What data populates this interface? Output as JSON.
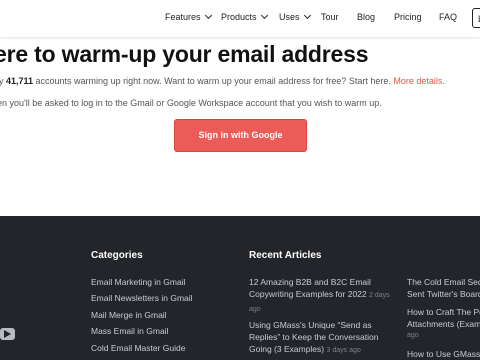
{
  "nav": {
    "features": "Features",
    "products": "Products",
    "uses": "Uses",
    "tour": "Tour",
    "blog": "Blog",
    "pricing": "Pricing",
    "faq": "FAQ",
    "login_partial": "L"
  },
  "hero": {
    "title": "ere to warm-up your email address",
    "line1_prefix": "ly ",
    "count": "41,711",
    "line1_middle": " accounts warming up right now. Want to warm up your email address for free? Start here. ",
    "more_link": "More details.",
    "line2": "en you'll be asked to log in to the Gmail or Google Workspace account that you wish to warm up.",
    "signin_label": "Sign in with Google"
  },
  "footer": {
    "categories_heading": "Categories",
    "categories": [
      "Email Marketing in Gmail",
      "Email Newsletters in Gmail",
      "Mail Merge in Gmail",
      "Mass Email in Gmail",
      "Cold Email Master Guide"
    ],
    "recent_heading": "Recent Articles",
    "articles": [
      {
        "title": "12 Amazing B2B and B2C Email Copywriting Examples for 2022",
        "date": "2 days ago"
      },
      {
        "title": "Using GMass's Unique “Send as Replies” to Keep the Conversation Going (3 Examples)",
        "date": "3 days ago"
      }
    ],
    "articles_col3": [
      {
        "line1": "The Cold Email Sequ",
        "line2": "Sent Twitter's Board"
      },
      {
        "line1": "How to Craft The Pe",
        "line2": "Attachments (Exam",
        "date": "ago"
      },
      {
        "line1": "How to Use GMass's"
      }
    ]
  },
  "colors": {
    "accent": "#eb5c58",
    "link": "#e2574c",
    "footer_bg": "#23252a"
  }
}
